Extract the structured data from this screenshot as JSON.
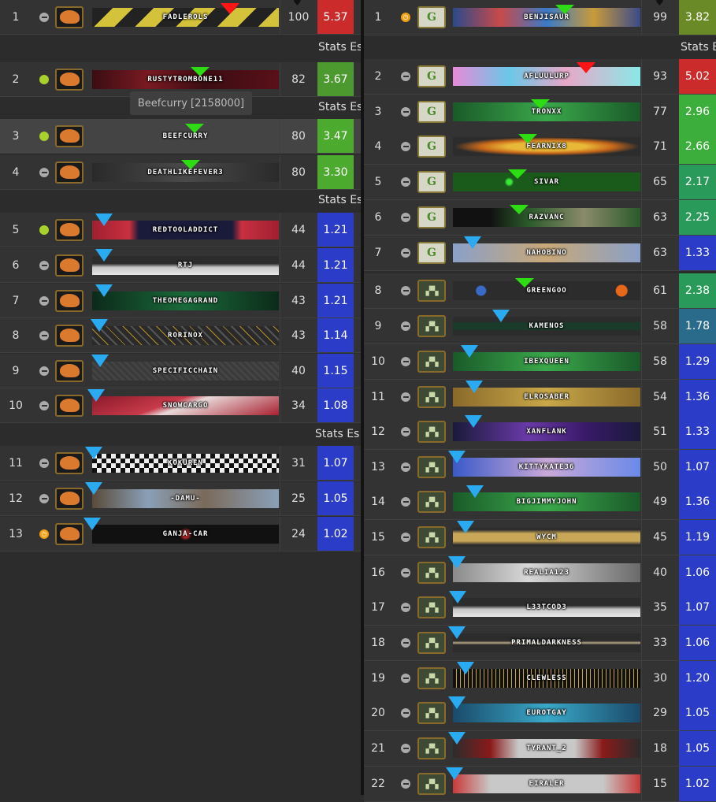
{
  "stats_label": "Stats Es",
  "tooltip": "Beefcurry [2158000]",
  "left": [
    {
      "rank": "1",
      "status": "idle",
      "game": "mam",
      "name": "FADLEROLS",
      "score": "100",
      "ratio": "5.37",
      "color": "#cc2b2b",
      "arrow": "red",
      "banner": "linear-gradient(135deg,#222 0 10%,#d4c23a 10% 20%,#222 20% 30%,#d4c23a 30% 40%,#222 40% 50%,#d4c23a 50% 60%,#222 60% 70%,#d4c23a 70% 80%,#222 80% 90%,#d4c23a 90%)"
    },
    {
      "rank": "2",
      "status": "online",
      "game": "mam",
      "name": "RUSTYTROMBONE11",
      "score": "82",
      "ratio": "3.67",
      "color": "#4c9a2f",
      "arrow": "green",
      "banner": "linear-gradient(90deg,#3a0d12,#7a1a22 30%,#3a0d12 60%,#5a1018)"
    },
    {
      "rank": "3",
      "status": "online",
      "game": "mam",
      "name": "BEEFCURRY",
      "score": "80",
      "ratio": "3.47",
      "color": "#4cab2f",
      "arrow": "green",
      "banner": "transparent"
    },
    {
      "rank": "4",
      "status": "idle",
      "game": "mam",
      "name": "DEATHLIKEFEVER3",
      "score": "80",
      "ratio": "3.30",
      "color": "#4cab2f",
      "arrow": "green",
      "banner": "linear-gradient(90deg,#2a2a2a,#4a4a4a 50%,#2a2a2a)"
    },
    {
      "rank": "5",
      "status": "online",
      "game": "mam",
      "name": "REDTOOLADDICT",
      "score": "44",
      "ratio": "1.21",
      "color": "#2a3cc8",
      "arrow": "blue",
      "banner": "linear-gradient(90deg,#a02030,#c83040 20%,#1a1a3a 25% 75%,#c83040 80%,#a02030)"
    },
    {
      "rank": "6",
      "status": "idle",
      "game": "mam",
      "name": "RTJ",
      "score": "44",
      "ratio": "1.21",
      "color": "#2a3cc8",
      "arrow": "blue",
      "banner": "linear-gradient(180deg,#2c2c2c 40%,#c8c8c8 60%,#e8e8e8)"
    },
    {
      "rank": "7",
      "status": "idle",
      "game": "mam",
      "name": "THEOMEGAGRAND",
      "score": "43",
      "ratio": "1.21",
      "color": "#2a3cc8",
      "arrow": "blue",
      "banner": "linear-gradient(90deg,#0c2a1a,#1a6a3a 50%,#0c2a1a)"
    },
    {
      "rank": "8",
      "status": "idle",
      "game": "mam",
      "name": "RORINOX",
      "score": "43",
      "ratio": "1.14",
      "color": "#2a3cc8",
      "arrow": "blue",
      "banner": "repeating-linear-gradient(45deg,#2a2a2a 0 6px,#555 6px 8px,#2a2a2a 8px 14px,#b8902a 14px 15px)"
    },
    {
      "rank": "9",
      "status": "idle",
      "game": "mam",
      "name": "SPECIFICCHAIN",
      "score": "40",
      "ratio": "1.15",
      "color": "#2a3cc8",
      "arrow": "blue",
      "banner": "repeating-linear-gradient(45deg,#3a3a3a 0 3px,#444 3px 6px)"
    },
    {
      "rank": "10",
      "status": "idle",
      "game": "mam",
      "name": "SNOWCARGO",
      "score": "34",
      "ratio": "1.08",
      "color": "#2a3cc8",
      "arrow": "blue",
      "banner": "linear-gradient(160deg,#8a1a2a,#c83a4a 40%,#e8d8d8 50%,#a82030)"
    },
    {
      "rank": "11",
      "status": "idle",
      "game": "mam",
      "name": "KOKUREN",
      "score": "31",
      "ratio": "1.07",
      "color": "#2a3cc8",
      "arrow": "blue",
      "banner": "repeating-conic-gradient(#111 0 25%,#eee 0 50%) 0 0/12px 12px"
    },
    {
      "rank": "12",
      "status": "idle",
      "game": "mam",
      "name": "-DAMU-",
      "score": "25",
      "ratio": "1.05",
      "color": "#2a3cc8",
      "arrow": "blue",
      "banner": "linear-gradient(90deg,#5a4a3a,#8aa0b8 30%,#7a6a5a 60%,#8aa0b8)"
    },
    {
      "rank": "13",
      "status": "away",
      "game": "mam",
      "name": "GANJA-CAR",
      "score": "24",
      "ratio": "1.02",
      "color": "#2a3cc8",
      "arrow": "blue",
      "banner": "radial-gradient(circle at 50% 50%,#c82a2a 0 4px,#111 8px)"
    }
  ],
  "right": [
    {
      "rank": "1",
      "status": "away",
      "game": "gg",
      "name": "BENJISAUR",
      "score": "99",
      "ratio": "3.82",
      "color": "#6a8a28",
      "arrow": "green",
      "banner": "linear-gradient(90deg,#2a4a8a,#c84a4a 25%,#3a7ac8 50%,#c89a3a 75%,#3a4a8a)"
    },
    {
      "rank": "2",
      "status": "idle",
      "game": "gg",
      "name": "AFLUULURP",
      "score": "93",
      "ratio": "5.02",
      "color": "#cc2b2b",
      "arrow": "red",
      "banner": "linear-gradient(90deg,#e88ad8,#6ac8e8 30%,#e8a8c8 60%,#8ae8e8)"
    },
    {
      "rank": "3",
      "status": "idle",
      "game": "gg",
      "name": "TRONXX",
      "score": "77",
      "ratio": "2.96",
      "color": "#3cae3c",
      "arrow": "green",
      "banner": "linear-gradient(90deg,#1a5a2a,#3aa84a 50%,#1a5a2a)"
    },
    {
      "rank": "4",
      "status": "idle",
      "game": "gg",
      "name": "FEARNIX8",
      "score": "71",
      "ratio": "2.66",
      "color": "#3cae3c",
      "arrow": "green",
      "banner": "radial-gradient(ellipse at 50% 50%,#e8b838 0 30%,#c8681a 50%,#2c2c2c 70%)"
    },
    {
      "rank": "5",
      "status": "idle",
      "game": "gg",
      "name": "SIVAR",
      "score": "65",
      "ratio": "2.17",
      "color": "#2a9a5a",
      "arrow": "green",
      "banner": "radial-gradient(circle at 30% 50%,#3ae83a 0 3px,#1a5a1a 6px)"
    },
    {
      "rank": "6",
      "status": "idle",
      "game": "gg",
      "name": "RAZVANC",
      "score": "63",
      "ratio": "2.25",
      "color": "#2a9a5a",
      "arrow": "green",
      "banner": "linear-gradient(90deg,#111 20%,#2a5a2a 40%,#8a8a6a 70%,#2a5a2a)"
    },
    {
      "rank": "7",
      "status": "idle",
      "game": "gg",
      "name": "NAHOBINO",
      "score": "63",
      "ratio": "1.33",
      "color": "#2a3cc8",
      "arrow": "blue",
      "banner": "linear-gradient(90deg,#8aa0c8,#c8a878 50%,#8aa0c8)"
    },
    {
      "rank": "8",
      "status": "idle",
      "game": "map",
      "name": "GREENGOO",
      "score": "61",
      "ratio": "2.38",
      "color": "#2a9a5a",
      "arrow": "green",
      "banner": "radial-gradient(circle at 15% 50%,#3a6ac8 0 6px,transparent 7px),radial-gradient(circle at 90% 50%,#e8681a 0 7px,transparent 8px),#2c2c2c"
    },
    {
      "rank": "9",
      "status": "idle",
      "game": "map",
      "name": "KAMENOS",
      "score": "58",
      "ratio": "1.78",
      "color": "#2a6a8a",
      "arrow": "blue",
      "banner": "linear-gradient(180deg,#2c2c2c 30%,#1a3a2a 30% 70%,#2c2c2c 70%)"
    },
    {
      "rank": "10",
      "status": "idle",
      "game": "map",
      "name": "IBEXQUEEN",
      "score": "58",
      "ratio": "1.29",
      "color": "#2a3cc8",
      "arrow": "blue",
      "banner": "linear-gradient(90deg,#1a5a2a,#3aa84a 50%,#1a5a2a)"
    },
    {
      "rank": "11",
      "status": "idle",
      "game": "map",
      "name": "ELROSABER",
      "score": "54",
      "ratio": "1.36",
      "color": "#2a3cc8",
      "arrow": "blue",
      "banner": "linear-gradient(90deg,#8a6a2a,#c8a848 50%,#8a6a2a)"
    },
    {
      "rank": "12",
      "status": "idle",
      "game": "map",
      "name": "XANFLANK",
      "score": "51",
      "ratio": "1.33",
      "color": "#2a3cc8",
      "arrow": "blue",
      "banner": "linear-gradient(90deg,#1a1a3a,#6a3aa8 40%,#3a1a6a 70%,#1a1a3a)"
    },
    {
      "rank": "13",
      "status": "idle",
      "game": "map",
      "name": "KITTYKATE36",
      "score": "50",
      "ratio": "1.07",
      "color": "#2a3cc8",
      "arrow": "blue",
      "banner": "linear-gradient(90deg,#3a5ac8,#c8a8d8 50%,#6a8ae8)"
    },
    {
      "rank": "14",
      "status": "idle",
      "game": "map",
      "name": "BIGJIMMYJOHN",
      "score": "49",
      "ratio": "1.36",
      "color": "#2a3cc8",
      "arrow": "blue",
      "banner": "linear-gradient(90deg,#1a5a2a,#3aa84a 50%,#1a5a2a)"
    },
    {
      "rank": "15",
      "status": "idle",
      "game": "map",
      "name": "WYCM",
      "score": "45",
      "ratio": "1.19",
      "color": "#2a3cc8",
      "arrow": "blue",
      "banner": "linear-gradient(180deg,#2c2c2c 10%,#c8a858 30% 70%,#2c2c2c 90%)"
    },
    {
      "rank": "16",
      "status": "idle",
      "game": "map",
      "name": "REALIA123",
      "score": "40",
      "ratio": "1.06",
      "color": "#2a3cc8",
      "arrow": "blue",
      "banner": "linear-gradient(90deg,#8a8a8a,#d8d8d8 40%,#6a6a6a)"
    },
    {
      "rank": "17",
      "status": "idle",
      "game": "map",
      "name": "L33TCOD3",
      "score": "35",
      "ratio": "1.07",
      "color": "#2a3cc8",
      "arrow": "blue",
      "banner": "linear-gradient(180deg,#2c2c2c 40%,#c8c8c8 60%,#e8e8e8)"
    },
    {
      "rank": "18",
      "status": "idle",
      "game": "map",
      "name": "PRIMALDARKNESS",
      "score": "33",
      "ratio": "1.06",
      "color": "#2a3cc8",
      "arrow": "blue",
      "banner": "linear-gradient(180deg,#2c2c2c 40%,#b8a888 50%,#2c2c2c 60%)"
    },
    {
      "rank": "19",
      "status": "idle",
      "game": "map",
      "name": "CLEWLESS",
      "score": "30",
      "ratio": "1.20",
      "color": "#2a3cc8",
      "arrow": "blue",
      "banner": "repeating-linear-gradient(90deg,#111 0 4px,#c8a838 4px 5px)"
    },
    {
      "rank": "20",
      "status": "idle",
      "game": "map",
      "name": "EUROTGAY",
      "score": "29",
      "ratio": "1.05",
      "color": "#2a3cc8",
      "arrow": "blue",
      "banner": "linear-gradient(90deg,#1a4a6a,#3aa8c8 50%,#1a4a6a)"
    },
    {
      "rank": "21",
      "status": "idle",
      "game": "map",
      "name": "TYRANT_2",
      "score": "18",
      "ratio": "1.05",
      "color": "#2a3cc8",
      "arrow": "blue",
      "banner": "linear-gradient(90deg,#2c2c2c,#8a1a1a 20%,#c8c8c8 35% 65%,#8a1a1a 80%,#2c2c2c)"
    },
    {
      "rank": "22",
      "status": "idle",
      "game": "map",
      "name": "EIRALER",
      "score": "15",
      "ratio": "1.02",
      "color": "#2a3cc8",
      "arrow": "blue",
      "banner": "linear-gradient(90deg,#c83a3a,#c8c8c8 20% 80%,#c83a3a)"
    }
  ]
}
